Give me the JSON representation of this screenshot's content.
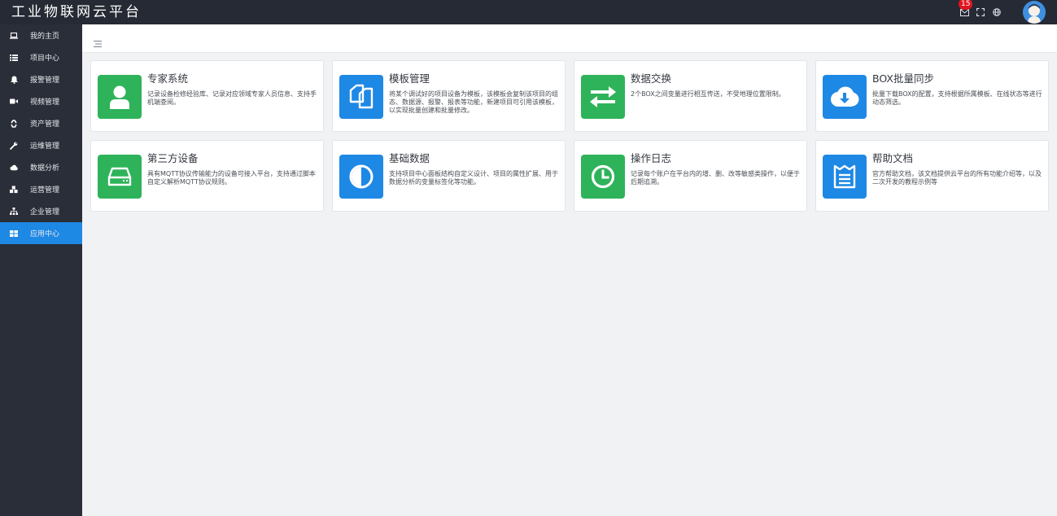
{
  "app": {
    "title": "工业物联网云平台"
  },
  "header": {
    "notification_count": "15"
  },
  "sidebar": {
    "items": [
      {
        "label": "我的主页",
        "icon": "laptop-icon"
      },
      {
        "label": "项目中心",
        "icon": "list-icon"
      },
      {
        "label": "报警管理",
        "icon": "bell-icon"
      },
      {
        "label": "视频管理",
        "icon": "video-camera-icon"
      },
      {
        "label": "资产管理",
        "icon": "recycle-icon"
      },
      {
        "label": "运维管理",
        "icon": "wrench-icon"
      },
      {
        "label": "数据分析",
        "icon": "cloud-icon"
      },
      {
        "label": "运营管理",
        "icon": "cubes-icon"
      },
      {
        "label": "企业管理",
        "icon": "sitemap-icon"
      },
      {
        "label": "应用中心",
        "icon": "grid-icon",
        "active": true
      }
    ]
  },
  "apps": [
    {
      "title": "专家系统",
      "desc": "记录设备检修经验库、记录对应领域专家人员信息、支持手机端查阅。",
      "icon": "user-icon",
      "color": "#2eb35a"
    },
    {
      "title": "模板管理",
      "desc": "将某个调试好的项目设备为模板，该模板会复制该项目的组态、数据源、报警、报表等功能，新建项目可引用该模板，以实现批量创建和批量修改。",
      "icon": "copy-icon",
      "color": "#1e88e5"
    },
    {
      "title": "数据交换",
      "desc": "2个BOX之间变量进行相互传送，不受地理位置限制。",
      "icon": "exchange-icon",
      "color": "#2eb35a"
    },
    {
      "title": "BOX批量同步",
      "desc": "批量下载BOX的配置，支持根据所属模板、在线状态等进行动态筛选。",
      "icon": "cloud-download-icon",
      "color": "#1e88e5"
    },
    {
      "title": "第三方设备",
      "desc": "具有MQTT协议传输能力的设备可接入平台，支持通过脚本自定义解析MQTT协议规则。",
      "icon": "hdd-icon",
      "color": "#2eb35a"
    },
    {
      "title": "基础数据",
      "desc": "支持项目中心面板结构自定义设计、项目的属性扩展、用于数据分析的变量标签化等功能。",
      "icon": "contrast-icon",
      "color": "#1e88e5"
    },
    {
      "title": "操作日志",
      "desc": "记录每个账户在平台内的增、删、改等敏感类操作，以便于后期追溯。",
      "icon": "clock-icon",
      "color": "#2eb35a"
    },
    {
      "title": "帮助文档",
      "desc": "官方帮助文档，该文档提供云平台的所有功能介绍等，以及二次开发的教程示例等",
      "icon": "newspaper-icon",
      "color": "#1e88e5"
    }
  ]
}
